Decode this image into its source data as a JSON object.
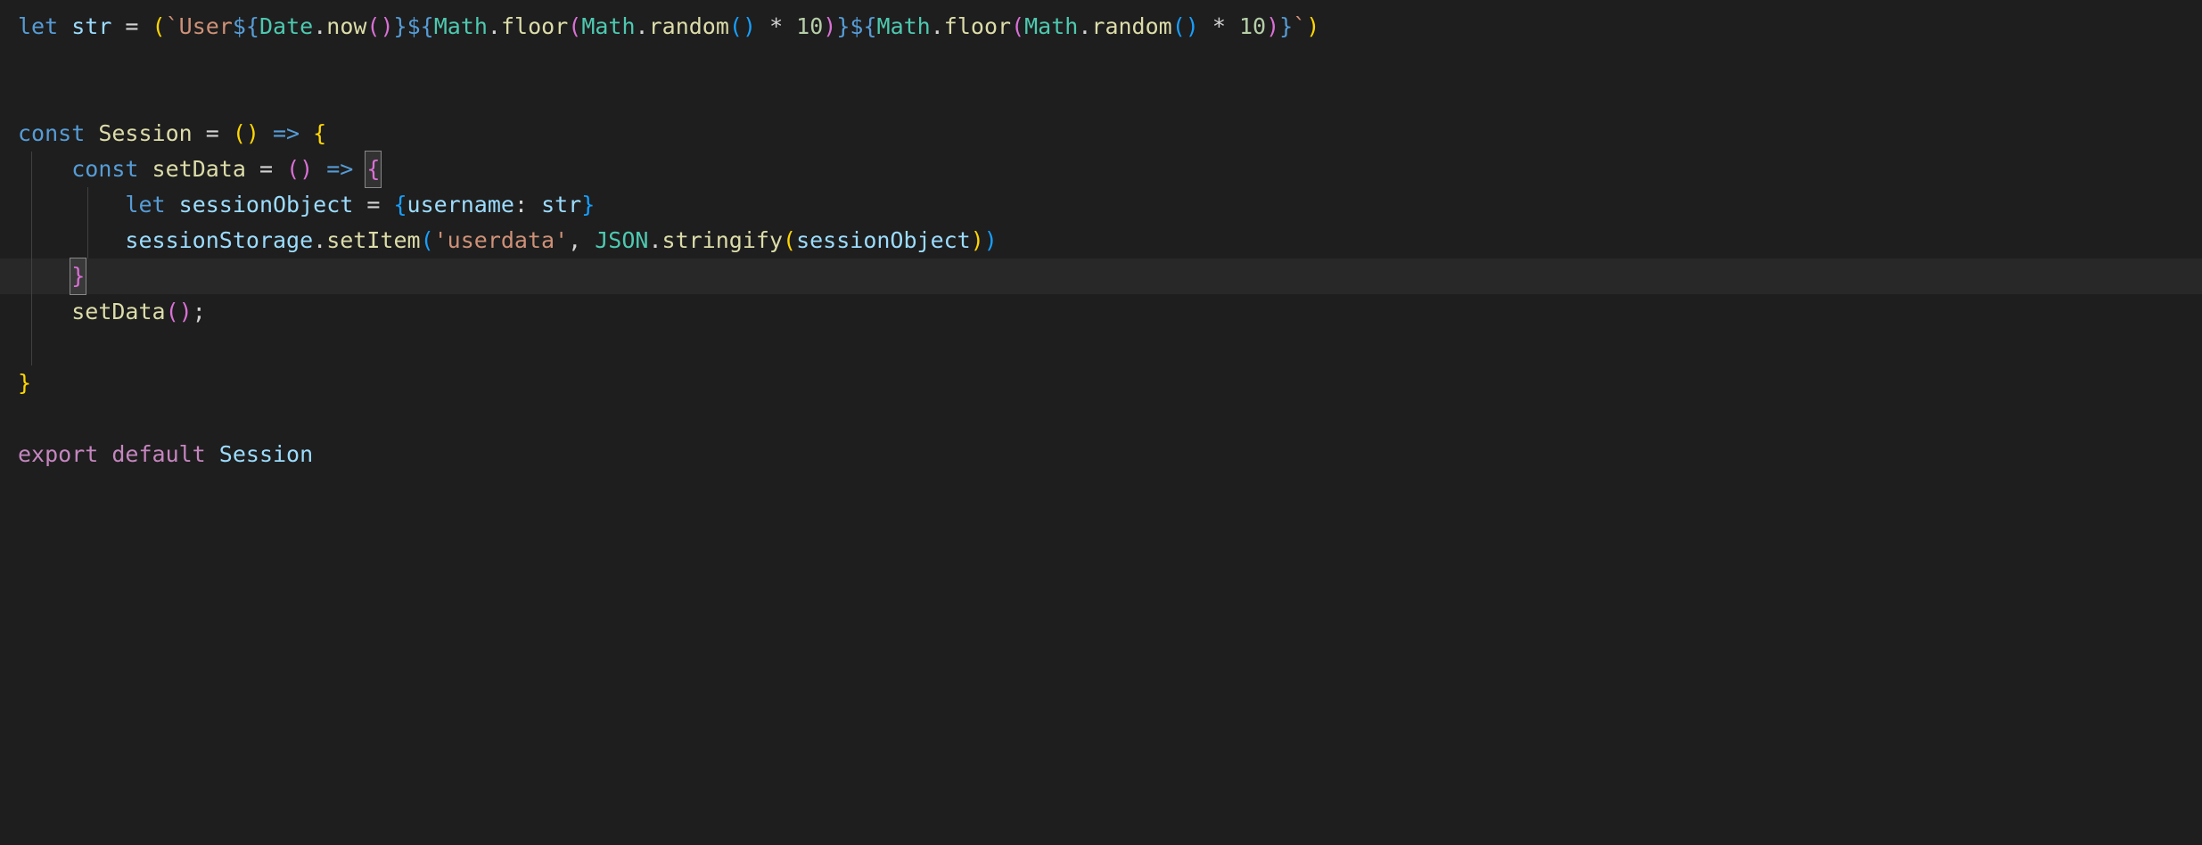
{
  "code": {
    "line1": {
      "let": "let",
      "str": "str",
      "eq": " = ",
      "openParen": "(",
      "backtick1": "`",
      "userText": "User",
      "dollar1": "${",
      "dateClass": "Date",
      "dot1": ".",
      "nowFn": "now",
      "nowParens": "()",
      "closeBrace1": "}",
      "dollar2": "${",
      "mathClass1": "Math",
      "dot2": ".",
      "floorFn1": "floor",
      "floorOpen1": "(",
      "mathClass2": "Math",
      "dot3": ".",
      "randomFn1": "random",
      "randomParens1": "()",
      "mult1": " * ",
      "ten1": "10",
      "floorClose1": ")",
      "closeBrace2": "}",
      "dollar3": "${",
      "mathClass3": "Math",
      "dot4": ".",
      "floorFn2": "floor",
      "floorOpen2": "(",
      "mathClass4": "Math",
      "dot5": ".",
      "randomFn2": "random",
      "randomParens2": "()",
      "mult2": " * ",
      "ten2": "10",
      "floorClose2": ")",
      "closeBrace3": "}",
      "backtick2": "`",
      "closeParen": ")"
    },
    "line4": {
      "const": "const",
      "session": "Session",
      "eq": " = ",
      "parens": "()",
      "arrow": " => ",
      "brace": "{"
    },
    "line5": {
      "indent": "    ",
      "const": "const",
      "setData": "setData",
      "eq": " = ",
      "parens": "()",
      "arrow": " => ",
      "brace": "{"
    },
    "line6": {
      "indent": "        ",
      "let": "let",
      "sessionObject": "sessionObject",
      "eq": " = ",
      "openBrace": "{",
      "username": "username",
      "colon": ":",
      "space": " ",
      "str": "str",
      "closeBrace": "}"
    },
    "line7": {
      "indent": "        ",
      "sessionStorage": "sessionStorage",
      "dot1": ".",
      "setItem": "setItem",
      "openParen": "(",
      "userdata": "'userdata'",
      "comma": ", ",
      "json": "JSON",
      "dot2": ".",
      "stringify": "stringify",
      "openParen2": "(",
      "sessionObject": "sessionObject",
      "closeParen2": ")",
      "closeParen": ")"
    },
    "line8": {
      "indent": "    ",
      "brace": "}"
    },
    "line9": {
      "indent": "    ",
      "setData": "setData",
      "parens": "()",
      "semi": ";"
    },
    "line11": {
      "brace": "}"
    },
    "line13": {
      "export": "export",
      "default": "default",
      "session": "Session"
    }
  }
}
